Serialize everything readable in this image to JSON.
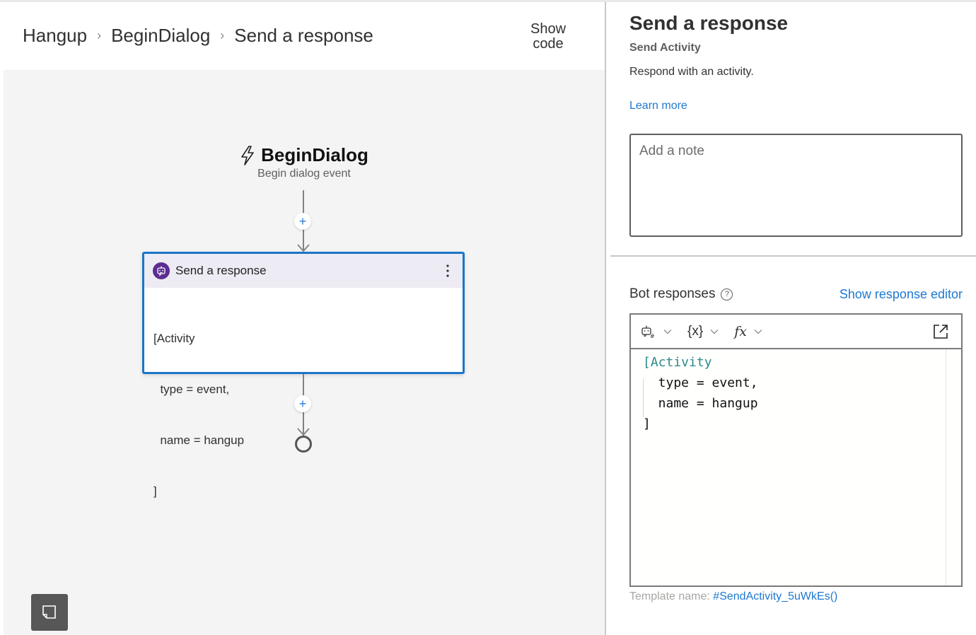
{
  "breadcrumb": {
    "items": [
      "Hangup",
      "BeginDialog",
      "Send a response"
    ],
    "separator": "›"
  },
  "header": {
    "show_code_label_line1": "Show",
    "show_code_label_line2": "code"
  },
  "canvas": {
    "trigger": {
      "title": "BeginDialog",
      "subtitle": "Begin dialog event",
      "icon": "lightning-icon"
    },
    "action_card": {
      "title": "Send a response",
      "icon": "bot-icon",
      "body_lines": [
        "[Activity",
        "  type = event,",
        "  name = hangup",
        "]"
      ]
    },
    "add_button_label": "+",
    "note_button_icon": "sticky-note-icon"
  },
  "panel": {
    "title": "Send a response",
    "subtitle": "Send Activity",
    "description": "Respond with an activity.",
    "learn_more": "Learn more",
    "note_placeholder": "Add a note",
    "bot_responses_label": "Bot responses",
    "help_icon_glyph": "?",
    "show_response_editor": "Show response editor",
    "toolbar": {
      "bot_icon": "bot-template-icon",
      "variables_label": "{x}",
      "functions_label": "fx",
      "popout_icon": "popout-icon"
    },
    "code_lines": [
      {
        "kw": "[Activity",
        "rest": ""
      },
      {
        "kw": "",
        "rest": "  type = event,"
      },
      {
        "kw": "",
        "rest": "  name = hangup"
      },
      {
        "kw": "",
        "rest": "]"
      }
    ],
    "template_name_label": "Template name:",
    "template_name_value": "#SendActivity_5uWkEs()"
  },
  "colors": {
    "accent": "#1b75c9",
    "link": "#1e78d2",
    "bot_badge": "#5c2d91",
    "card_header": "#edebf3",
    "canvas_bg": "#f4f4f4",
    "code_keyword": "#2a8a8a"
  }
}
